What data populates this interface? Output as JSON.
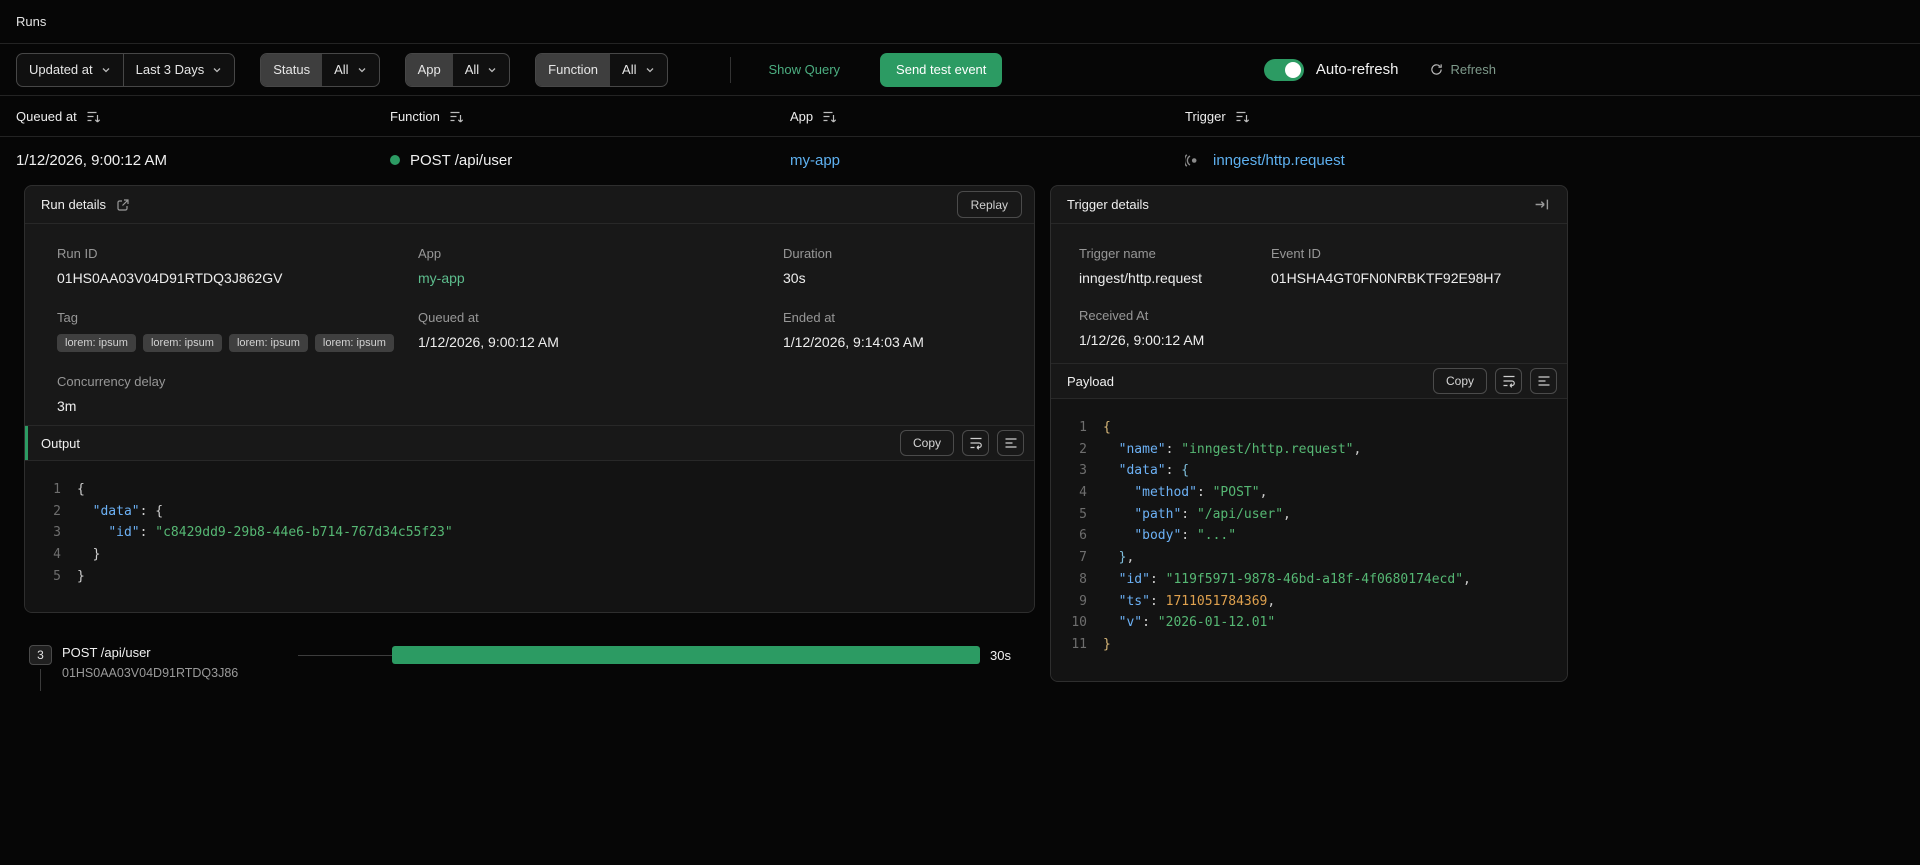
{
  "header": {
    "title": "Runs"
  },
  "filters": {
    "sort_field_label": "Updated at",
    "time_range_label": "Last 3 Days",
    "status": {
      "label": "Status",
      "value": "All"
    },
    "app": {
      "label": "App",
      "value": "All"
    },
    "function": {
      "label": "Function",
      "value": "All"
    },
    "show_query_label": "Show Query",
    "send_test_event_label": "Send test event",
    "auto_refresh_label": "Auto-refresh",
    "auto_refresh_enabled": true,
    "refresh_label": "Refresh"
  },
  "table": {
    "headers": [
      "Queued at",
      "Function",
      "App",
      "Trigger"
    ],
    "row": {
      "queued_at": "1/12/2026, 9:00:12 AM",
      "function_name": "POST /api/user",
      "app": "my-app",
      "trigger": "inngest/http.request"
    }
  },
  "run_details": {
    "title": "Run details",
    "replay_label": "Replay",
    "fields": {
      "run_id": {
        "label": "Run ID",
        "value": "01HS0AA03V04D91RTDQ3J862GV"
      },
      "app": {
        "label": "App",
        "value": "my-app"
      },
      "duration": {
        "label": "Duration",
        "value": "30s"
      },
      "tag": {
        "label": "Tag",
        "badges": [
          "lorem: ipsum",
          "lorem: ipsum",
          "lorem: ipsum",
          "lorem: ipsum"
        ]
      },
      "queued_at": {
        "label": "Queued at",
        "value": "1/12/2026, 9:00:12 AM"
      },
      "ended_at": {
        "label": "Ended at",
        "value": "1/12/2026, 9:14:03 AM"
      },
      "concurrency_delay": {
        "label": "Concurrency delay",
        "value": "3m"
      }
    }
  },
  "output": {
    "title": "Output",
    "copy_label": "Copy",
    "code": [
      [
        [
          "plain",
          "{"
        ]
      ],
      [
        [
          "plain",
          "  "
        ],
        [
          "key",
          "\"data\""
        ],
        [
          "plain",
          ": {"
        ]
      ],
      [
        [
          "plain",
          "    "
        ],
        [
          "key",
          "\"id\""
        ],
        [
          "plain",
          ": "
        ],
        [
          "string",
          "\"c8429dd9-29b8-44e6-b714-767d34c55f23\""
        ]
      ],
      [
        [
          "plain",
          "  }"
        ]
      ],
      [
        [
          "plain",
          "}"
        ]
      ]
    ]
  },
  "trigger_details": {
    "title": "Trigger details",
    "trigger_name": {
      "label": "Trigger name",
      "value": "inngest/http.request"
    },
    "event_id": {
      "label": "Event ID",
      "value": "01HSHA4GT0FN0NRBKTF92E98H7"
    },
    "received_at": {
      "label": "Received At",
      "value": "1/12/26, 9:00:12 AM"
    }
  },
  "payload": {
    "title": "Payload",
    "copy_label": "Copy",
    "code": [
      [
        [
          "brace1",
          "{"
        ]
      ],
      [
        [
          "plain",
          "  "
        ],
        [
          "key",
          "\"name\""
        ],
        [
          "plain",
          ": "
        ],
        [
          "string",
          "\"inngest/http.request\""
        ],
        [
          "plain",
          ","
        ]
      ],
      [
        [
          "plain",
          "  "
        ],
        [
          "key",
          "\"data\""
        ],
        [
          "plain",
          ": "
        ],
        [
          "brace2",
          "{"
        ]
      ],
      [
        [
          "plain",
          "    "
        ],
        [
          "key",
          "\"method\""
        ],
        [
          "plain",
          ": "
        ],
        [
          "string",
          "\"POST\""
        ],
        [
          "plain",
          ","
        ]
      ],
      [
        [
          "plain",
          "    "
        ],
        [
          "key",
          "\"path\""
        ],
        [
          "plain",
          ": "
        ],
        [
          "string",
          "\"/api/user\""
        ],
        [
          "plain",
          ","
        ]
      ],
      [
        [
          "plain",
          "    "
        ],
        [
          "key",
          "\"body\""
        ],
        [
          "plain",
          ": "
        ],
        [
          "string",
          "\"...\""
        ]
      ],
      [
        [
          "plain",
          "  "
        ],
        [
          "brace2",
          "}"
        ],
        [
          "plain",
          ","
        ]
      ],
      [
        [
          "plain",
          "  "
        ],
        [
          "key",
          "\"id\""
        ],
        [
          "plain",
          ": "
        ],
        [
          "string",
          "\"119f5971-9878-46bd-a18f-4f0680174ecd\""
        ],
        [
          "plain",
          ","
        ]
      ],
      [
        [
          "plain",
          "  "
        ],
        [
          "key",
          "\"ts\""
        ],
        [
          "plain",
          ": "
        ],
        [
          "number",
          "1711051784369"
        ],
        [
          "plain",
          ","
        ]
      ],
      [
        [
          "plain",
          "  "
        ],
        [
          "key",
          "\"v\""
        ],
        [
          "plain",
          ": "
        ],
        [
          "string",
          "\"2026-01-12.01\""
        ]
      ],
      [
        [
          "brace1",
          "}"
        ]
      ]
    ]
  },
  "timeline": {
    "step_number": "3",
    "step_name": "POST /api/user",
    "step_id": "01HS0AA03V04D91RTDQ3J86",
    "duration": "30s"
  },
  "colors": {
    "accent_green": "#2c9b63",
    "link_blue": "#5eb0ef",
    "app_link_green": "#5dbd8d",
    "code_key": "#6cb1f5",
    "code_string": "#56b874",
    "code_number": "#dfa14e"
  }
}
